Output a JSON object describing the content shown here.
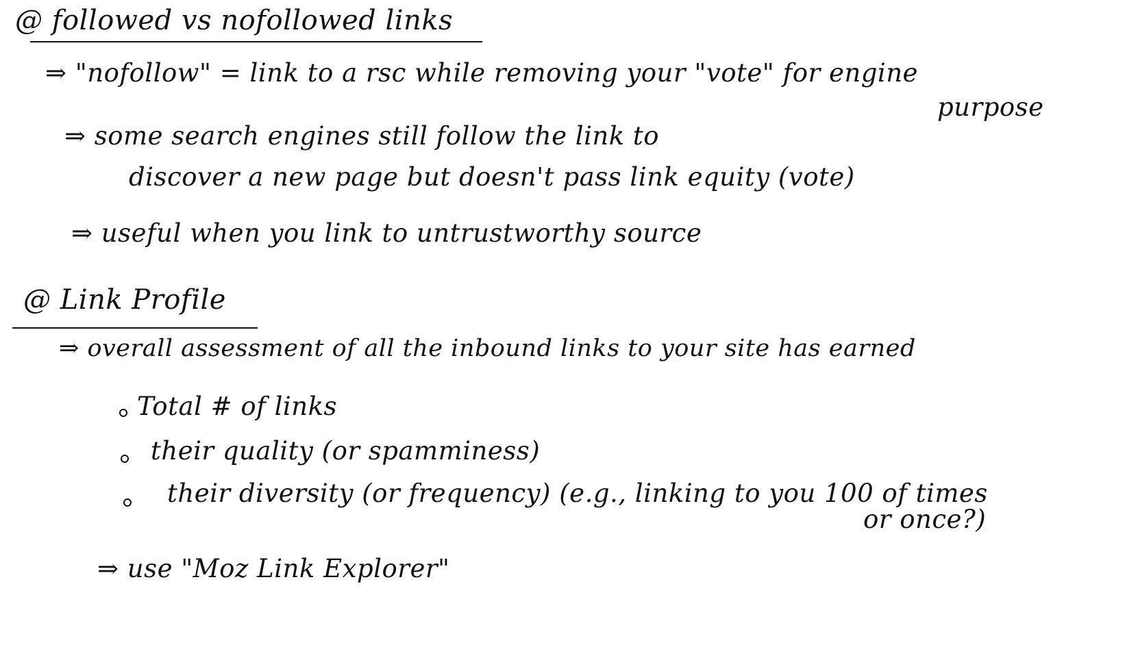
{
  "notes": {
    "heading1": "@ followed vs nofollowed links",
    "line1": "⇒ \"nofollow\" = link to a rsc while removing your \"vote\" for engine",
    "line1_cont": "purpose",
    "line2": "⇒ some search engines still follow the link to",
    "line2_cont": "discover a new page but doesn't pass link equity (vote)",
    "line3": "⇒ useful when you link to untrustworthy source",
    "heading2": "@ Link Profile",
    "line4": "⇒ overall assessment of all the inbound links to your site has earned",
    "bullet1": "Total # of links",
    "bullet2": "their quality (or spamminess)",
    "bullet3": "their diversity (or frequency) (e.g., linking to you 100 of times",
    "bullet3_cont": "or once?)",
    "line5": "⇒ use \"Moz Link Explorer\""
  }
}
